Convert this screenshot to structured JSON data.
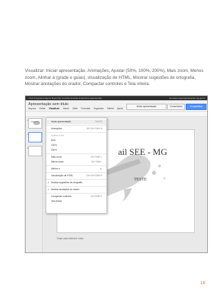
{
  "paragraph": "Visualizar: Iniciar apresentação, Animações, Ajustar (50%, 100%, 200%), Mais zoom, Menos zoom, Alinhar a (grade e guias), visualização de HTML, Mostrar sugestões de ortografia, Mostrar anotações do orador, Compactar controles e Tela inteira.",
  "screenshot": {
    "google_bar": {
      "links": "+Você  Pesquisa  Imagens  Maps  Play  YouTube  Notícias  Gmail  Drive  Agenda  Mais",
      "account": "fernanda.rogerio@educacao.mg.gov.br"
    },
    "doc_title": "Apresentação sem título",
    "menu_bar": [
      "Arquivo",
      "Editar",
      "Visualizar",
      "Inserir",
      "Slide",
      "Formatar",
      "Organizar",
      "Tabela",
      "Ajuda"
    ],
    "active_menu": "Visualizar",
    "saved_status": "Todas as alterações foram salvas",
    "buttons": {
      "present": "Iniciar apresentação",
      "comments": "Comentários",
      "share": "Compartilhar"
    },
    "slides": [
      {
        "number": "1"
      },
      {
        "number": "2"
      },
      {
        "number": "3"
      }
    ],
    "slide": {
      "title": "ail SEE - MG",
      "subtitle": "TESTE"
    },
    "notes_placeholder": "Clique para adicionar notas",
    "view_menu": [
      {
        "label": "Iniciar apresentação",
        "shortcut": "Ctrl+F5",
        "highlighted": true
      },
      {
        "label": "Animações",
        "shortcut": "Alt+Ctrl+Shift+A"
      },
      {
        "label": "Ajustar à tela",
        "dim": true
      },
      {
        "label": "50%"
      },
      {
        "label": "100%"
      },
      {
        "label": "200%"
      },
      {
        "label": "Mais zoom",
        "shortcut": "Ctrl+Shift+="
      },
      {
        "label": "Menos zoom",
        "shortcut": "Ctrl+Shift+-"
      },
      {
        "label": "Alinhar a"
      },
      {
        "label": "Visualização de HTML",
        "shortcut": "Ctrl+Alt+Shift+H"
      },
      {
        "label": "Mostrar sugestões de ortografia",
        "checked": true
      },
      {
        "label": "Mostrar anotações do orador",
        "checked": true
      },
      {
        "label": "Compactar controles",
        "shortcut": "Ctrl+Shift+F"
      },
      {
        "label": "Tela inteira"
      }
    ]
  },
  "page_number": "18",
  "colors": {
    "page_number": "#e0702a",
    "share_button": "#4d90fe",
    "google_bar": "#2d2d2d"
  }
}
